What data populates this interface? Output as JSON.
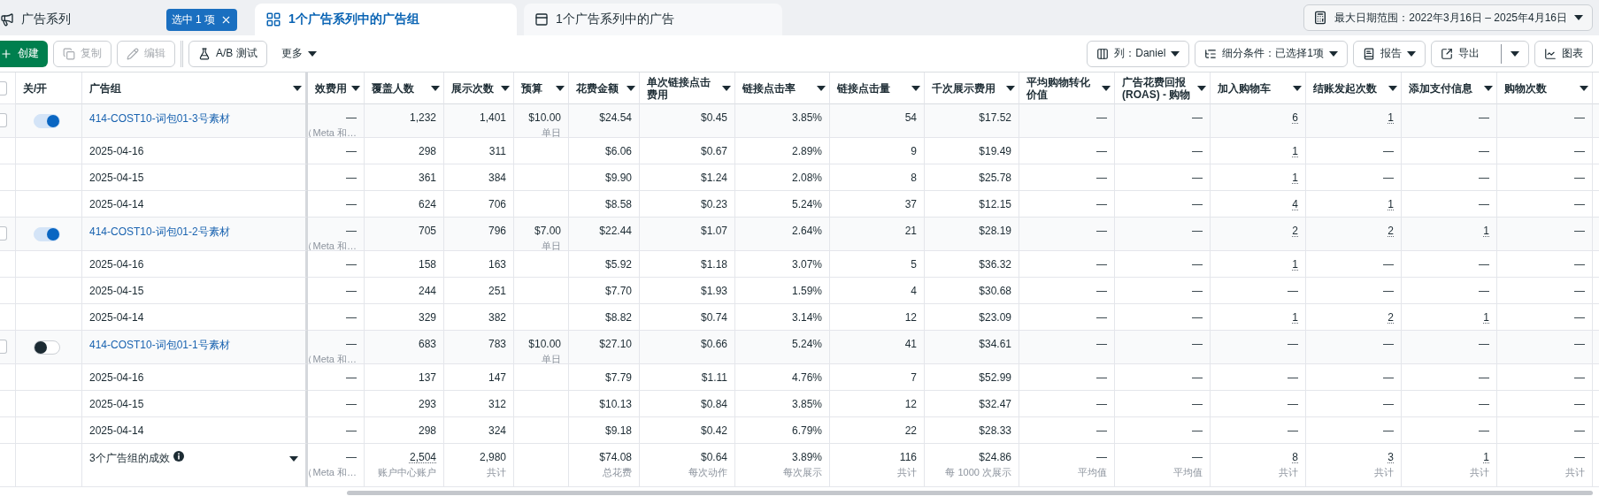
{
  "tabs": [
    {
      "label": "广告系列",
      "kind": "campaigns",
      "selected": false,
      "badge": "选中 1 项"
    },
    {
      "label": "1个广告系列中的广告组",
      "kind": "adsets",
      "selected": true
    },
    {
      "label": "1个广告系列中的广告",
      "kind": "ads",
      "selected": false
    }
  ],
  "date_range": "最大日期范围：2022年3月16日 – 2025年4月16日",
  "toolbar_left": [
    {
      "label": "创建",
      "kind": "create",
      "disabled": false
    },
    {
      "label": "复制",
      "kind": "copy",
      "disabled": true
    },
    {
      "label": "编辑",
      "kind": "edit",
      "disabled": true
    },
    {
      "label": "A/B 测试",
      "kind": "test",
      "disabled": false
    },
    {
      "label": "更多",
      "kind": "more",
      "disabled": false
    }
  ],
  "toolbar_right": [
    {
      "label": "列：Daniel",
      "kind": "columns"
    },
    {
      "label": "细分条件：已选择1项",
      "kind": "breakdown"
    },
    {
      "label": "报告",
      "kind": "reports"
    },
    {
      "label": "导出",
      "kind": "export"
    },
    {
      "label": "图表",
      "kind": "charts"
    }
  ],
  "table": {
    "all_checked": false,
    "toggle_header": {
      "label": "关/开",
      "menu": false
    },
    "name_header": {
      "label": "广告组",
      "menu": true
    },
    "columns": [
      {
        "label": "效费用",
        "menu": true
      },
      {
        "label": "覆盖人数",
        "menu": true
      },
      {
        "label": "展示次数",
        "menu": true
      },
      {
        "label": "预算",
        "menu": true
      },
      {
        "label": "花费金额",
        "menu": true
      },
      {
        "label": "单次链接点击费用",
        "menu": true
      },
      {
        "label": "链接点击率",
        "menu": true
      },
      {
        "label": "链接点击量",
        "menu": true
      },
      {
        "label": "千次展示费用",
        "menu": true
      },
      {
        "label": "平均购物转化价值",
        "menu": true
      },
      {
        "label": "广告花费回报 (ROAS) - 购物",
        "menu": true
      },
      {
        "label": "加入购物车",
        "menu": true
      },
      {
        "label": "结账发起次数",
        "menu": true
      },
      {
        "label": "添加支付信息",
        "menu": true
      },
      {
        "label": "购物次数",
        "menu": true
      }
    ],
    "rows": [
      {
        "kind": "adset",
        "name": "414-COST10-词包01-3号素材",
        "on": true,
        "checked": false,
        "cells": [
          {
            "text": "—",
            "sub": "（Meta 和…"
          },
          "1,232",
          "1,401",
          {
            "text": "$10.00",
            "sub": "单日"
          },
          "$24.54",
          "$0.45",
          "3.85%",
          "54",
          "$17.52",
          "—",
          "—",
          {
            "text": "6",
            "link": true
          },
          {
            "text": "1",
            "link": true
          },
          "—",
          "—"
        ]
      },
      {
        "kind": "day",
        "name": "2025-04-16",
        "cells": [
          "—",
          "298",
          "311",
          null,
          "$6.06",
          "$0.67",
          "2.89%",
          "9",
          "$19.49",
          "—",
          "—",
          {
            "text": "1",
            "link": true
          },
          "—",
          "—",
          "—"
        ]
      },
      {
        "kind": "day",
        "name": "2025-04-15",
        "cells": [
          "—",
          "361",
          "384",
          null,
          "$9.90",
          "$1.24",
          "2.08%",
          "8",
          "$25.78",
          "—",
          "—",
          {
            "text": "1",
            "link": true
          },
          "—",
          "—",
          "—"
        ]
      },
      {
        "kind": "day",
        "name": "2025-04-14",
        "cells": [
          "—",
          "624",
          "706",
          null,
          "$8.58",
          "$0.23",
          "5.24%",
          "37",
          "$12.15",
          "—",
          "—",
          {
            "text": "4",
            "link": true
          },
          {
            "text": "1",
            "link": true
          },
          "—",
          "—"
        ]
      },
      {
        "kind": "adset",
        "name": "414-COST10-词包01-2号素材",
        "on": true,
        "checked": false,
        "cells": [
          {
            "text": "—",
            "sub": "（Meta 和…"
          },
          "705",
          "796",
          {
            "text": "$7.00",
            "sub": "单日"
          },
          "$22.44",
          "$1.07",
          "2.64%",
          "21",
          "$28.19",
          "—",
          "—",
          {
            "text": "2",
            "link": true
          },
          {
            "text": "2",
            "link": true
          },
          {
            "text": "1",
            "link": true
          },
          "—"
        ]
      },
      {
        "kind": "day",
        "name": "2025-04-16",
        "cells": [
          "—",
          "158",
          "163",
          null,
          "$5.92",
          "$1.18",
          "3.07%",
          "5",
          "$36.32",
          "—",
          "—",
          {
            "text": "1",
            "link": true
          },
          "—",
          "—",
          "—"
        ]
      },
      {
        "kind": "day",
        "name": "2025-04-15",
        "cells": [
          "—",
          "244",
          "251",
          null,
          "$7.70",
          "$1.93",
          "1.59%",
          "4",
          "$30.68",
          "—",
          "—",
          "—",
          "—",
          "—",
          "—"
        ]
      },
      {
        "kind": "day",
        "name": "2025-04-14",
        "cells": [
          "—",
          "329",
          "382",
          null,
          "$8.82",
          "$0.74",
          "3.14%",
          "12",
          "$23.09",
          "—",
          "—",
          {
            "text": "1",
            "link": true
          },
          {
            "text": "2",
            "link": true
          },
          {
            "text": "1",
            "link": true
          },
          "—"
        ]
      },
      {
        "kind": "adset",
        "name": "414-COST10-词包01-1号素材",
        "on": false,
        "checked": false,
        "cells": [
          {
            "text": "—",
            "sub": "（Meta 和…"
          },
          "683",
          "783",
          {
            "text": "$10.00",
            "sub": "单日"
          },
          "$27.10",
          "$0.66",
          "5.24%",
          "41",
          "$34.61",
          "—",
          "—",
          "—",
          "—",
          "—",
          "—"
        ]
      },
      {
        "kind": "day",
        "name": "2025-04-16",
        "cells": [
          "—",
          "137",
          "147",
          null,
          "$7.79",
          "$1.11",
          "4.76%",
          "7",
          "$52.99",
          "—",
          "—",
          "—",
          "—",
          "—",
          "—"
        ]
      },
      {
        "kind": "day",
        "name": "2025-04-15",
        "cells": [
          "—",
          "293",
          "312",
          null,
          "$10.13",
          "$0.84",
          "3.85%",
          "12",
          "$32.47",
          "—",
          "—",
          "—",
          "—",
          "—",
          "—"
        ]
      },
      {
        "kind": "day",
        "name": "2025-04-14",
        "cells": [
          "—",
          "298",
          "324",
          null,
          "$9.18",
          "$0.42",
          "6.79%",
          "22",
          "$28.33",
          "—",
          "—",
          "—",
          "—",
          "—",
          "—"
        ]
      }
    ],
    "summary": {
      "title": "3个广告组的成效",
      "cells": [
        {
          "text": "—",
          "sub": "（Meta 和…"
        },
        {
          "text": "2,504",
          "sub": "账户中心账户",
          "link": true
        },
        {
          "text": "2,980",
          "sub": "共计"
        },
        null,
        {
          "text": "$74.08",
          "sub": "总花费"
        },
        {
          "text": "$0.64",
          "sub": "每次动作"
        },
        {
          "text": "3.89%",
          "sub": "每次展示"
        },
        {
          "text": "116",
          "sub": "共计"
        },
        {
          "text": "$24.86",
          "sub": "每 1000 次展示"
        },
        {
          "text": "—",
          "sub": "平均值"
        },
        {
          "text": "—",
          "sub": "平均值"
        },
        {
          "text": "8",
          "sub": "共计",
          "link": true
        },
        {
          "text": "3",
          "sub": "共计",
          "link": true
        },
        {
          "text": "1",
          "sub": "共计",
          "link": true
        },
        {
          "text": "—",
          "sub": "共计"
        }
      ]
    }
  }
}
